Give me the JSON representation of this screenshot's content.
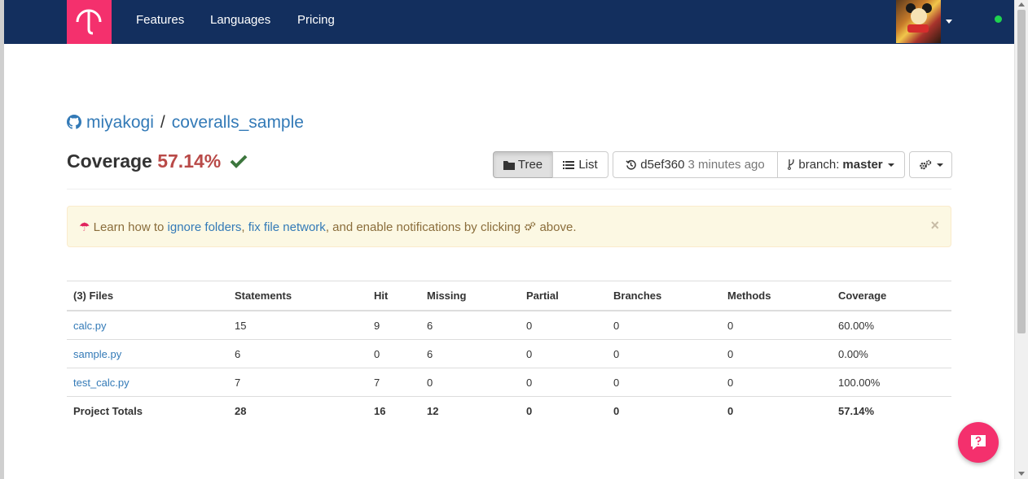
{
  "nav": {
    "links": [
      "Features",
      "Languages",
      "Pricing"
    ]
  },
  "repo": {
    "owner": "miyakogi",
    "separator": "/",
    "name": "coveralls_sample"
  },
  "coverage": {
    "label": "Coverage",
    "percent": "57.14%"
  },
  "toolbar": {
    "tree_label": "Tree",
    "list_label": "List",
    "commit": "d5ef360",
    "commit_time": "3 minutes ago",
    "branch_label": "branch:",
    "branch_name": "master"
  },
  "alert": {
    "prefix": "Learn how to",
    "link1": "ignore folders",
    "comma": ",",
    "link2": "fix file network",
    "middle": ", and enable notifications by clicking",
    "suffix": "above.",
    "close": "×"
  },
  "table": {
    "headers": [
      "(3) Files",
      "Statements",
      "Hit",
      "Missing",
      "Partial",
      "Branches",
      "Methods",
      "Coverage"
    ],
    "rows": [
      [
        "calc.py",
        "15",
        "9",
        "6",
        "0",
        "0",
        "0",
        "60.00%"
      ],
      [
        "sample.py",
        "6",
        "0",
        "6",
        "0",
        "0",
        "0",
        "0.00%"
      ],
      [
        "test_calc.py",
        "7",
        "7",
        "0",
        "0",
        "0",
        "0",
        "100.00%"
      ]
    ],
    "totals": [
      "Project Totals",
      "28",
      "16",
      "12",
      "0",
      "0",
      "0",
      "57.14%"
    ]
  },
  "colors": {
    "navbar": "#132f5e",
    "brand": "#f4306d",
    "link": "#337ab7",
    "coverage_pct": "#b94a48",
    "success": "#3c763d"
  }
}
